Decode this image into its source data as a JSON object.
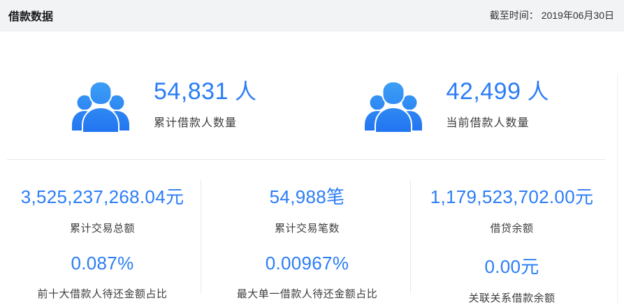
{
  "header": {
    "title": "借款数据",
    "as_of_label": "截至时间：",
    "as_of_date": "2019年06月30日"
  },
  "colors": {
    "accent_blue": "#2b7df6",
    "icon_blue_top": "#3fa3f6",
    "icon_blue_bottom": "#2173f0",
    "header_bg": "#f2f3f5",
    "label_text": "#3d3d3d",
    "divider": "#e8e8e8"
  },
  "top_stats": [
    {
      "icon": "people-group-icon",
      "value": "54,831",
      "unit": "人",
      "label": "累计借款人数量"
    },
    {
      "icon": "people-group-icon",
      "value": "42,499",
      "unit": "人",
      "label": "当前借款人数量"
    }
  ],
  "grid_stats": {
    "row1": [
      {
        "value": "3,525,237,268.04",
        "unit": "元",
        "label": "累计交易总额"
      },
      {
        "value": "54,988",
        "unit": "笔",
        "label": "累计交易笔数"
      },
      {
        "value": "1,179,523,702.00",
        "unit": "元",
        "label": "借贷余额"
      }
    ],
    "row2": [
      {
        "value": "0.087",
        "unit": "%",
        "label": "前十大借款人待还金额占比"
      },
      {
        "value": "0.00967",
        "unit": "%",
        "label": "最大单一借款人待还金额占比"
      },
      {
        "value": "0.00",
        "unit": "元",
        "label": "关联关系借款余额"
      }
    ]
  }
}
